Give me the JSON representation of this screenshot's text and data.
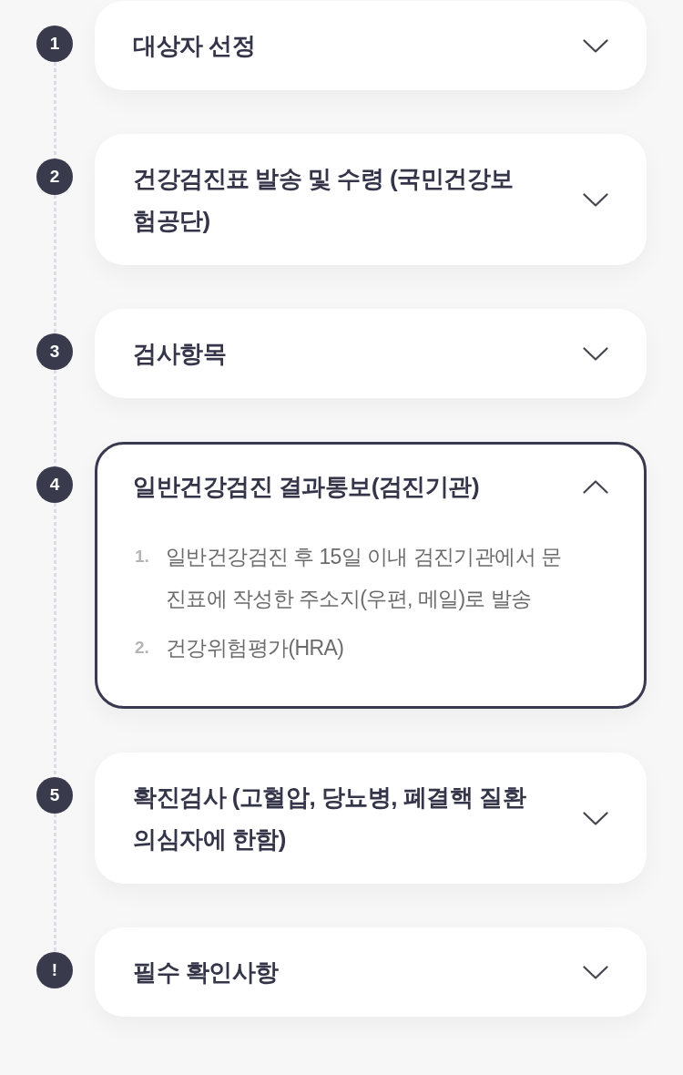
{
  "steps": [
    {
      "marker": "1",
      "title": "대상자 선정",
      "expanded": false
    },
    {
      "marker": "2",
      "title": "건강검진표 발송 및 수령 (국민건강보험공단)",
      "expanded": false
    },
    {
      "marker": "3",
      "title": "검사항목",
      "expanded": false
    },
    {
      "marker": "4",
      "title": "일반건강검진 결과통보(검진기관)",
      "expanded": true,
      "content": [
        {
          "number": "1.",
          "text": "일반건강검진 후 15일 이내 검진기관에서 문진표에 작성한 주소지(우편, 메일)로 발송"
        },
        {
          "number": "2.",
          "text": "건강위험평가(HRA)"
        }
      ]
    },
    {
      "marker": "5",
      "title": "확진검사 (고혈압, 당뇨병, 폐결핵 질환 의심자에 한함)",
      "expanded": false
    },
    {
      "marker": "!",
      "title": "필수 확인사항",
      "expanded": false
    }
  ]
}
